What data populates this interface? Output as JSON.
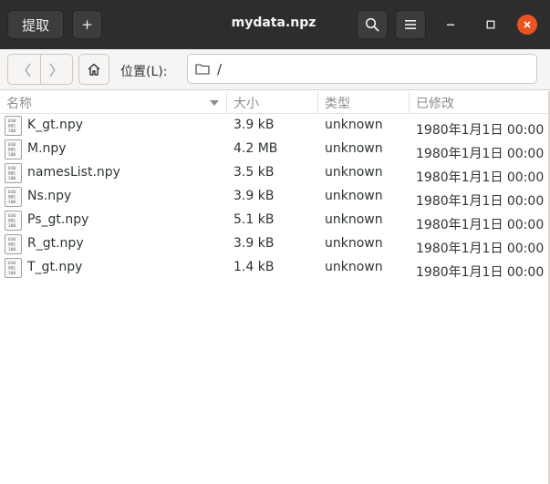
{
  "header": {
    "extract_label": "提取",
    "add_label": "+",
    "title": "mydata.npz",
    "search_icon": "search-icon",
    "menu_icon": "menu-icon",
    "minimize_icon": "minimize-icon",
    "maximize_icon": "maximize-icon",
    "close_icon": "close-icon",
    "close_color": "#e95420"
  },
  "toolbar": {
    "back_glyph": "〈",
    "forward_glyph": "〉",
    "home_icon": "home-icon",
    "location_label": "位置(L):",
    "folder_icon": "folder-icon",
    "path": "/"
  },
  "columns": {
    "name": "名称",
    "size": "大小",
    "type": "类型",
    "modified": "已修改"
  },
  "files": [
    {
      "name": "K_gt.npy",
      "size": "3.9 kB",
      "type": "unknown",
      "modified": "1980年1月1日 00:00"
    },
    {
      "name": "M.npy",
      "size": "4.2 MB",
      "type": "unknown",
      "modified": "1980年1月1日 00:00"
    },
    {
      "name": "namesList.npy",
      "size": "3.5 kB",
      "type": "unknown",
      "modified": "1980年1月1日 00:00"
    },
    {
      "name": "Ns.npy",
      "size": "3.9 kB",
      "type": "unknown",
      "modified": "1980年1月1日 00:00"
    },
    {
      "name": "Ps_gt.npy",
      "size": "5.1 kB",
      "type": "unknown",
      "modified": "1980年1月1日 00:00"
    },
    {
      "name": "R_gt.npy",
      "size": "3.9 kB",
      "type": "unknown",
      "modified": "1980年1月1日 00:00"
    },
    {
      "name": "T_gt.npy",
      "size": "1.4 kB",
      "type": "unknown",
      "modified": "1980年1月1日 00:00"
    }
  ]
}
